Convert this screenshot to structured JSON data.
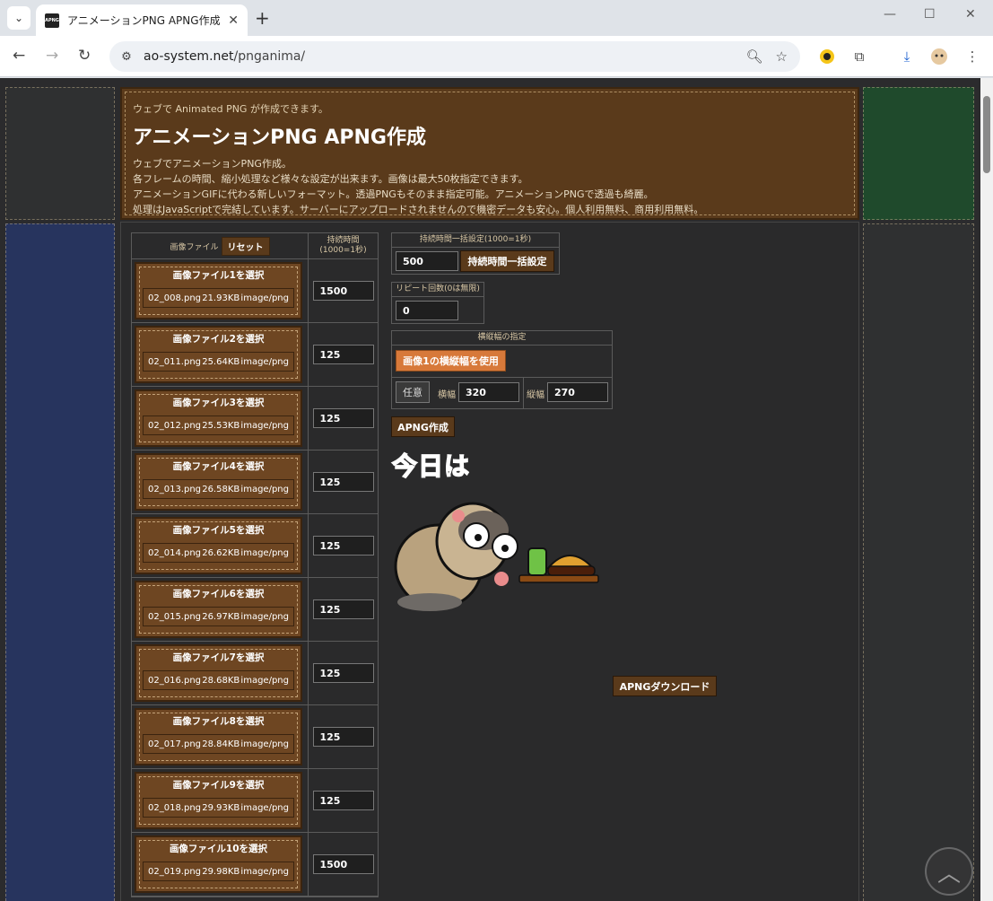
{
  "browser": {
    "tab_title": "アニメーションPNG APNG作成 ウェブでアニメーションPNG作成",
    "url_host": "ao-system.net",
    "url_path": "/pnganima/"
  },
  "header": {
    "subtitle": "ウェブで Animated PNG が作成できます。",
    "title": "アニメーションPNG APNG作成",
    "desc": [
      "ウェブでアニメーションPNG作成。",
      "各フレームの時間、縮小処理など様々な設定が出来ます。画像は最大50枚指定できます。",
      "アニメーションGIFに代わる新しいフォーマット。透過PNGもそのまま指定可能。アニメーションPNGで透過も綺麗。",
      "処理はJavaScriptで完結しています。サーバーにアップロードされませんので機密データも安心。個人利用無料、商用利用無料。"
    ]
  },
  "file_table": {
    "col_file": "画像ファイル",
    "reset_label": "リセット",
    "col_duration_line1": "持続時間",
    "col_duration_line2": "(1000=1秒)",
    "rows": [
      {
        "label": "画像ファイル1を選択",
        "name": "02_008.png",
        "size": "21.93KB",
        "type": "image/png",
        "duration": "1500"
      },
      {
        "label": "画像ファイル2を選択",
        "name": "02_011.png",
        "size": "25.64KB",
        "type": "image/png",
        "duration": "125"
      },
      {
        "label": "画像ファイル3を選択",
        "name": "02_012.png",
        "size": "25.53KB",
        "type": "image/png",
        "duration": "125"
      },
      {
        "label": "画像ファイル4を選択",
        "name": "02_013.png",
        "size": "26.58KB",
        "type": "image/png",
        "duration": "125"
      },
      {
        "label": "画像ファイル5を選択",
        "name": "02_014.png",
        "size": "26.62KB",
        "type": "image/png",
        "duration": "125"
      },
      {
        "label": "画像ファイル6を選択",
        "name": "02_015.png",
        "size": "26.97KB",
        "type": "image/png",
        "duration": "125"
      },
      {
        "label": "画像ファイル7を選択",
        "name": "02_016.png",
        "size": "28.68KB",
        "type": "image/png",
        "duration": "125"
      },
      {
        "label": "画像ファイル8を選択",
        "name": "02_017.png",
        "size": "28.84KB",
        "type": "image/png",
        "duration": "125"
      },
      {
        "label": "画像ファイル9を選択",
        "name": "02_018.png",
        "size": "29.93KB",
        "type": "image/png",
        "duration": "125"
      },
      {
        "label": "画像ファイル10を選択",
        "name": "02_019.png",
        "size": "29.98KB",
        "type": "image/png",
        "duration": "1500"
      }
    ]
  },
  "settings": {
    "bulk_title": "持続時間一括設定(1000=1秒)",
    "bulk_value": "500",
    "bulk_button": "持続時間一括設定",
    "repeat_title": "リピート回数(0は無限)",
    "repeat_value": "0",
    "size_title": "横縦幅の指定",
    "use_image1_button": "画像1の横縦幅を使用",
    "any_button": "任意",
    "width_label": "横幅",
    "width_value": "320",
    "height_label": "縦幅",
    "height_value": "270",
    "create_button": "APNG作成",
    "download_button": "APNGダウンロード"
  },
  "preview": {
    "text": "今日は"
  },
  "icons": {
    "tab_menu": "chevron-down-icon",
    "back": "arrow-left-icon",
    "forward": "arrow-right-icon",
    "reload": "reload-icon",
    "site_info": "tune-icon",
    "zoom": "zoom-icon",
    "bookmark": "star-icon",
    "page_top": "chevron-up-icon"
  }
}
